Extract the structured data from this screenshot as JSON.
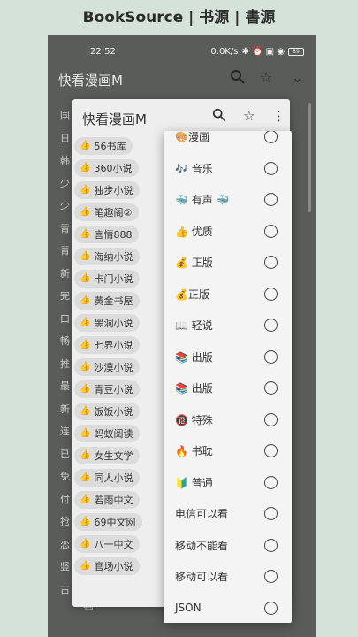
{
  "banner": "BookSource | 书源 | 書源",
  "status": {
    "time": "22:52",
    "speed": "0.0K/s",
    "icons": "✱ ⏰ ▣ ◉",
    "battery": "89"
  },
  "background": {
    "title": "快看漫画M",
    "list": [
      "国",
      "日",
      "韩",
      "少",
      "少",
      "青",
      "青",
      "新",
      "完",
      "口",
      "畅",
      "推",
      "最",
      "新",
      "连",
      "已",
      "免",
      "付",
      "抢",
      "恋",
      "竖",
      "古"
    ]
  },
  "dialog": {
    "title": "快看漫画M",
    "chips": [
      {
        "icon": "👍",
        "label": "56书库"
      },
      {
        "icon": "👍",
        "label": "360小说"
      },
      {
        "icon": "👍",
        "label": "独步小说"
      },
      {
        "icon": "👍",
        "label": "笔趣阁②"
      },
      {
        "icon": "👍",
        "label": "言情888"
      },
      {
        "icon": "👍",
        "label": "海纳小说"
      },
      {
        "icon": "👍",
        "label": "卡门小说"
      },
      {
        "icon": "👍",
        "label": "黄金书屋"
      },
      {
        "icon": "👍",
        "label": "黑洞小说"
      },
      {
        "icon": "👍",
        "label": "七界小说"
      },
      {
        "icon": "👍",
        "label": "沙漠小说"
      },
      {
        "icon": "👍",
        "label": "青豆小说"
      },
      {
        "icon": "👍",
        "label": "饭饭小说"
      },
      {
        "icon": "👍",
        "label": "蚂蚁阅读"
      },
      {
        "icon": "👍",
        "label": "女生文学"
      },
      {
        "icon": "👍",
        "label": "同人小说"
      },
      {
        "icon": "👍",
        "label": "若雨中文"
      },
      {
        "icon": "👍",
        "label": "69中文网"
      },
      {
        "icon": "👍",
        "label": "八一中文"
      },
      {
        "icon": "👍",
        "label": "官场小说"
      }
    ]
  },
  "menu": {
    "items": [
      "🎨漫画",
      "🎶 音乐",
      "🐳 有声 🐳",
      "👍 优质",
      "💰 正版",
      "💰正版",
      "📖 轻说",
      "📚  出版",
      "📚 出版",
      "🔞 特殊",
      "🔥 书耽",
      "🔰 普通",
      "电信可以看",
      "移动不能看",
      "移动可以看",
      "JSON"
    ]
  }
}
